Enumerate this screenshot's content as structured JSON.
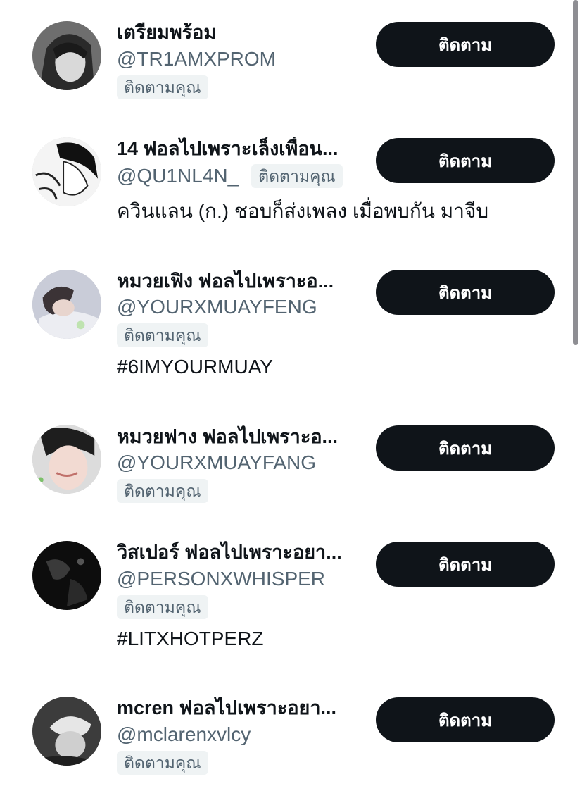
{
  "follow_label": "ติดตาม",
  "follows_you_label": "ติดตามคุณ",
  "users": [
    {
      "name": "เตรียมพร้อม",
      "handle": "@TR1AMXPROM",
      "bio": ""
    },
    {
      "name": "14 ฟอลไปเพราะเล็งเพื่อน...",
      "handle": "@QU1NL4N_",
      "bio": "ควินแลน (ก.) ชอบก็ส่งเพลง เมื่อพบกัน มาจีบ"
    },
    {
      "name": "หมวยเฟิง ฟอลไปเพราะอ...",
      "handle": "@YOURXMUAYFENG",
      "bio": "#6IMYOURMUAY"
    },
    {
      "name": "หมวยฟาง ฟอลไปเพราะอ...",
      "handle": "@YOURXMUAYFANG",
      "bio": ""
    },
    {
      "name": "วิสเปอร์ ฟอลไปเพราะอยา...",
      "handle": "@PERSONXWHISPER",
      "bio": "#LITXHOTPERZ"
    },
    {
      "name": "mcren ฟอลไปเพราะอยา...",
      "handle": "@mclarenxvlcy",
      "bio": ""
    }
  ]
}
